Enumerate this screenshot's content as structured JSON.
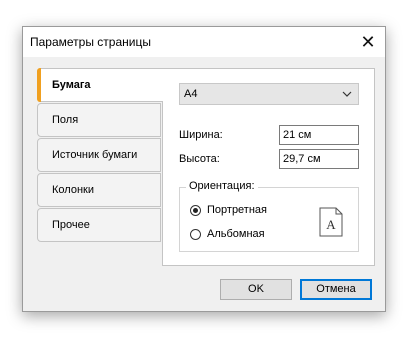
{
  "dialog": {
    "title": "Параметры страницы",
    "close_glyph": "✕"
  },
  "tabs": [
    {
      "label": "Бумага",
      "active": true
    },
    {
      "label": "Поля",
      "active": false
    },
    {
      "label": "Источник бумаги",
      "active": false
    },
    {
      "label": "Колонки",
      "active": false
    },
    {
      "label": "Прочее",
      "active": false
    }
  ],
  "paper": {
    "size_value": "A4",
    "width_label": "Ширина:",
    "width_value": "21 см",
    "height_label": "Высота:",
    "height_value": "29,7 см",
    "orientation": {
      "title": "Ориентация:",
      "portrait_label": "Портретная",
      "landscape_label": "Альбомная",
      "selected": "portrait",
      "icon_letter": "A"
    }
  },
  "buttons": {
    "ok_label": "OK",
    "cancel_label": "Отмена"
  },
  "colors": {
    "accent": "#f0a020",
    "default_button_border": "#0078d7"
  },
  "icons": {
    "close": "close-icon",
    "dropdown": "chevron-down-icon",
    "orientation_preview": "page-portrait-icon"
  }
}
